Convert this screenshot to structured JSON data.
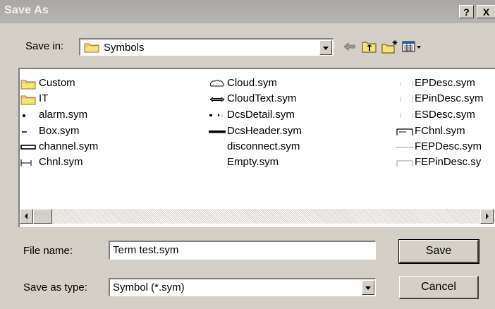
{
  "window": {
    "title": "Save As",
    "help_label": "?",
    "close_label": "X"
  },
  "save_in": {
    "label": "Save in:",
    "value": "Symbols"
  },
  "toolbar": {
    "icons": [
      "back-arrow-icon",
      "up-one-level-icon",
      "new-folder-icon",
      "view-menu-icon"
    ]
  },
  "files": {
    "column1": [
      "Custom",
      "IT",
      "alarm.sym",
      "Box.sym",
      "channel.sym",
      "Chnl.sym"
    ],
    "column2": [
      "Cloud.sym",
      "CloudText.sym",
      "DcsDetail.sym",
      "DcsHeader.sym",
      "disconnect.sym",
      "Empty.sym"
    ],
    "column3": [
      "EPDesc.sym",
      "EPinDesc.sym",
      "ESDesc.sym",
      "FChnl.sym",
      "FEPDesc.sym",
      "FEPinDesc.sy"
    ]
  },
  "file_name": {
    "label": "File name:",
    "value": "Term test.sym"
  },
  "save_as_type": {
    "label": "Save as type:",
    "value": "Symbol (*.sym)"
  },
  "buttons": {
    "save": "Save",
    "cancel": "Cancel"
  },
  "colors": {
    "dialog_bg": "#d4d0c8",
    "titlebar": "#afaeab",
    "folder_yellow": "#f6e27a"
  }
}
